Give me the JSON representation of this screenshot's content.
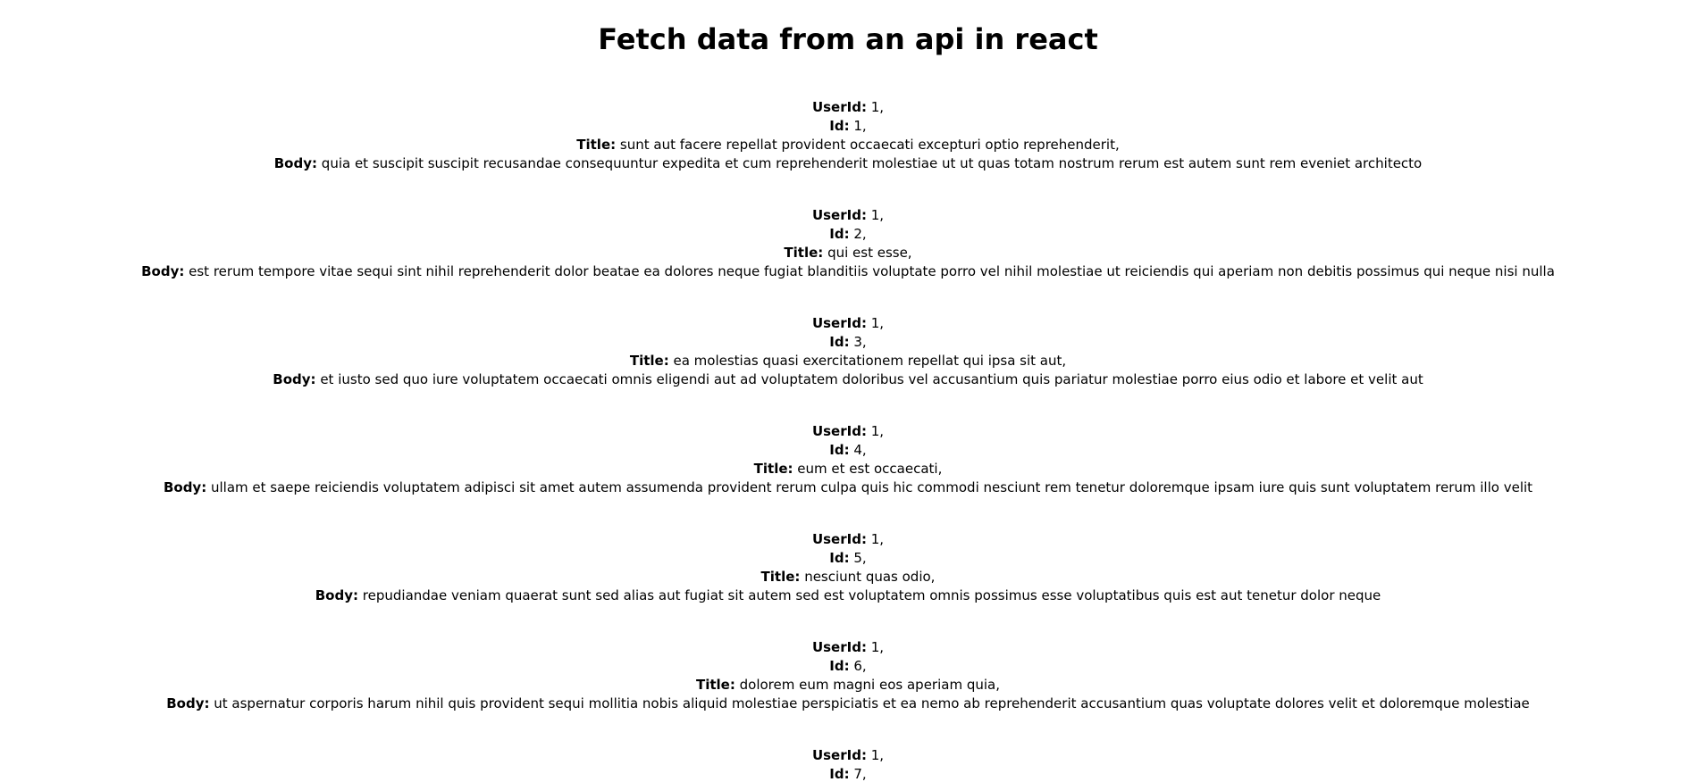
{
  "page": {
    "title": "Fetch data from an api in react"
  },
  "labels": {
    "userId": "UserId:",
    "id": "Id:",
    "title": "Title:",
    "body": "Body:"
  },
  "posts": [
    {
      "userId": "1,",
      "id": "1,",
      "title": "sunt aut facere repellat provident occaecati excepturi optio reprehenderit,",
      "body": "quia et suscipit suscipit recusandae consequuntur expedita et cum reprehenderit molestiae ut ut quas totam nostrum rerum est autem sunt rem eveniet architecto"
    },
    {
      "userId": "1,",
      "id": "2,",
      "title": "qui est esse,",
      "body": "est rerum tempore vitae sequi sint nihil reprehenderit dolor beatae ea dolores neque fugiat blanditiis voluptate porro vel nihil molestiae ut reiciendis qui aperiam non debitis possimus qui neque nisi nulla"
    },
    {
      "userId": "1,",
      "id": "3,",
      "title": "ea molestias quasi exercitationem repellat qui ipsa sit aut,",
      "body": "et iusto sed quo iure voluptatem occaecati omnis eligendi aut ad voluptatem doloribus vel accusantium quis pariatur molestiae porro eius odio et labore et velit aut"
    },
    {
      "userId": "1,",
      "id": "4,",
      "title": "eum et est occaecati,",
      "body": "ullam et saepe reiciendis voluptatem adipisci sit amet autem assumenda provident rerum culpa quis hic commodi nesciunt rem tenetur doloremque ipsam iure quis sunt voluptatem rerum illo velit"
    },
    {
      "userId": "1,",
      "id": "5,",
      "title": "nesciunt quas odio,",
      "body": "repudiandae veniam quaerat sunt sed alias aut fugiat sit autem sed est voluptatem omnis possimus esse voluptatibus quis est aut tenetur dolor neque"
    },
    {
      "userId": "1,",
      "id": "6,",
      "title": "dolorem eum magni eos aperiam quia,",
      "body": "ut aspernatur corporis harum nihil quis provident sequi mollitia nobis aliquid molestiae perspiciatis et ea nemo ab reprehenderit accusantium quas voluptate dolores velit et doloremque molestiae"
    },
    {
      "userId": "1,",
      "id": "7,"
    }
  ]
}
